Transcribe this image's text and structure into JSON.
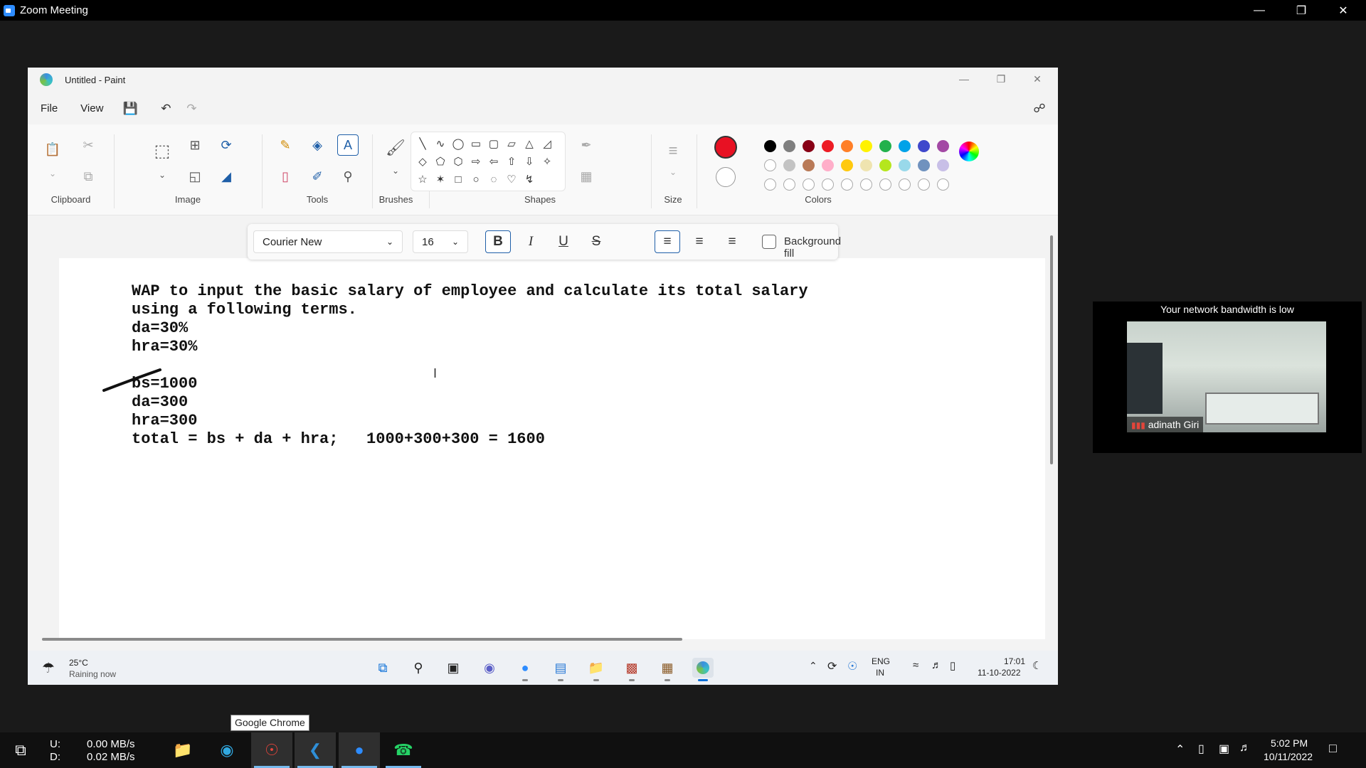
{
  "zoom": {
    "title": "Zoom Meeting",
    "minimize_icon": "minimize-icon",
    "restore_icon": "restore-icon",
    "close_icon": "close-icon"
  },
  "paint": {
    "title": "Untitled - Paint",
    "menu": {
      "file": "File",
      "view": "View"
    },
    "ribbon": {
      "groups": {
        "clipboard": "Clipboard",
        "image": "Image",
        "tools": "Tools",
        "brushes": "Brushes",
        "shapes": "Shapes",
        "size": "Size",
        "colors": "Colors"
      }
    },
    "colors": {
      "primary": "#e81123",
      "secondary": "#ffffff",
      "row1": [
        "#000000",
        "#7f7f7f",
        "#880015",
        "#ed1c24",
        "#ff7f27",
        "#fff200",
        "#22b14c",
        "#00a2e8",
        "#3f48cc",
        "#a349a4"
      ],
      "row2": [
        "#ffffff",
        "#c3c3c3",
        "#b97a57",
        "#ffaec9",
        "#ffc90e",
        "#efe4b0",
        "#b5e61d",
        "#99d9ea",
        "#7092be",
        "#c8bfe7"
      ]
    },
    "text_toolbar": {
      "font": "Courier New",
      "size": "16",
      "bold": "B",
      "italic": "I",
      "underline": "U",
      "strike": "S",
      "background_fill": "Background fill"
    },
    "canvas_lines": [
      "WAP to input the basic salary of employee and calculate its total salary",
      "using a following terms.",
      "da=30%",
      "hra=30%",
      "",
      "bs=1000",
      "da=300",
      "hra=300",
      "total = bs + da + hra;   1000+300+300 = 1600"
    ]
  },
  "inner_taskbar": {
    "weather_temp": "25°C",
    "weather_desc": "Raining now",
    "lang": "ENG",
    "region": "IN",
    "time": "17:01",
    "date": "11-10-2022"
  },
  "video": {
    "notice": "Your network bandwidth is low",
    "participant": "adinath Giri"
  },
  "tooltip": "Google Chrome",
  "taskbar": {
    "upload_label": "U:",
    "download_label": "D:",
    "upload_speed": "0.00 MB/s",
    "download_speed": "0.02 MB/s",
    "time": "5:02 PM",
    "date": "10/11/2022"
  }
}
